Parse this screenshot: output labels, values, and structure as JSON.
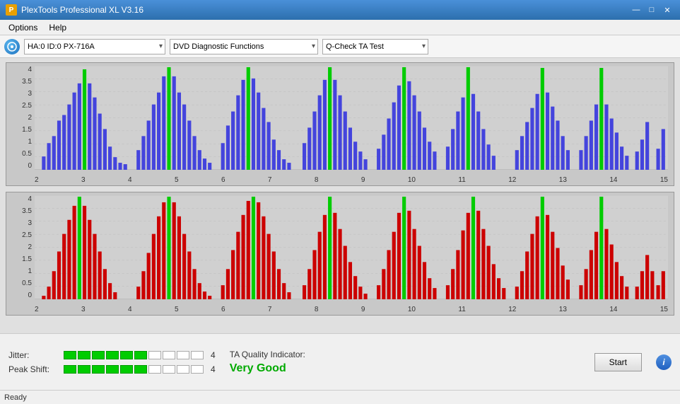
{
  "titleBar": {
    "title": "PlexTools Professional XL V3.16",
    "minimizeLabel": "—",
    "maximizeLabel": "□",
    "closeLabel": "✕"
  },
  "menuBar": {
    "items": [
      "Options",
      "Help"
    ]
  },
  "toolbar": {
    "driveValue": "HA:0 ID:0  PX-716A",
    "functionValue": "DVD Diagnostic Functions",
    "testValue": "Q-Check TA Test"
  },
  "charts": {
    "yAxisLabels": [
      "4",
      "3.5",
      "3",
      "2.5",
      "2",
      "1.5",
      "1",
      "0.5",
      "0"
    ],
    "xAxisLabels": [
      "2",
      "3",
      "4",
      "5",
      "6",
      "7",
      "8",
      "9",
      "10",
      "11",
      "12",
      "13",
      "14",
      "15"
    ]
  },
  "metrics": {
    "jitterLabel": "Jitter:",
    "jitterValue": "4",
    "jitterFilledSegments": 6,
    "jitterTotalSegments": 10,
    "peakShiftLabel": "Peak Shift:",
    "peakShiftValue": "4",
    "peakShiftFilledSegments": 6,
    "peakShiftTotalSegments": 10,
    "taQualityLabel": "TA Quality Indicator:",
    "taQualityValue": "Very Good"
  },
  "buttons": {
    "startLabel": "Start",
    "infoLabel": "i"
  },
  "statusBar": {
    "text": "Ready"
  }
}
